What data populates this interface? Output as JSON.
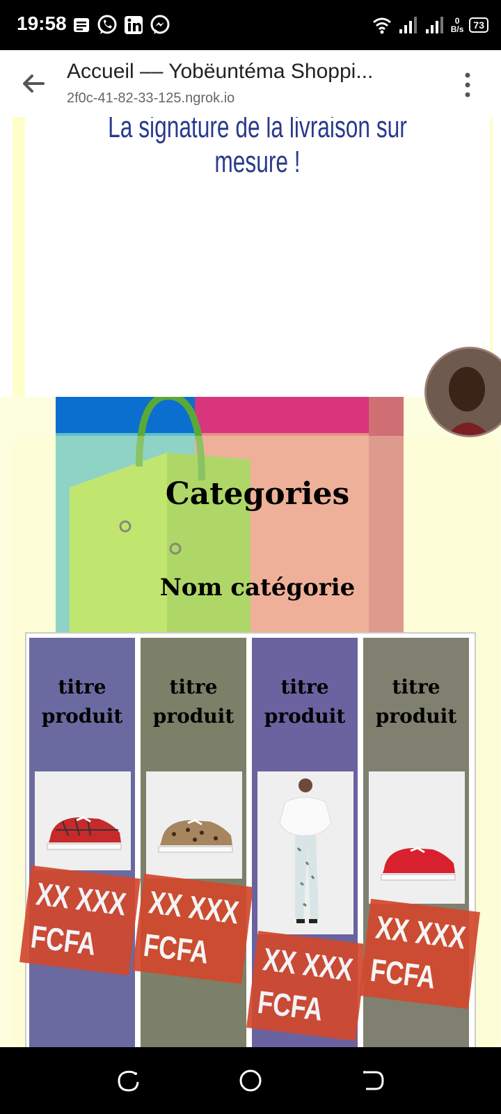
{
  "status_bar": {
    "time": "19:58",
    "net_speed_value": "0",
    "net_speed_unit": "B/s",
    "battery": "73"
  },
  "browser": {
    "tab_title": "Accueil –– Yobëuntéma Shoppi...",
    "url": "2f0c-41-82-33-125.ngrok.io"
  },
  "banner": {
    "tagline": "La signature de la livraison sur mesure !"
  },
  "categories": {
    "title": "Categories",
    "category_name": "Nom catégorie",
    "products": [
      {
        "title_line1": "titre",
        "title_line2": "produit",
        "price_line1": "XX XXX",
        "price_line2": "FCFA",
        "image": "red-plaid-sneaker",
        "panel_color": "#6b6aa0"
      },
      {
        "title_line1": "titre",
        "title_line2": "produit",
        "price_line1": "XX XXX",
        "price_line2": "FCFA",
        "image": "leopard-sneaker",
        "panel_color": "#7d8068"
      },
      {
        "title_line1": "titre",
        "title_line2": "produit",
        "price_line1": "XX XXX",
        "price_line2": "FCFA",
        "image": "woman-fashion-outfit",
        "panel_color": "#6b62a0"
      },
      {
        "title_line1": "titre",
        "title_line2": "produit",
        "price_line1": "XX XXX",
        "price_line2": "FCFA",
        "image": "red-canvas-sneaker",
        "panel_color": "#808070"
      }
    ]
  }
}
